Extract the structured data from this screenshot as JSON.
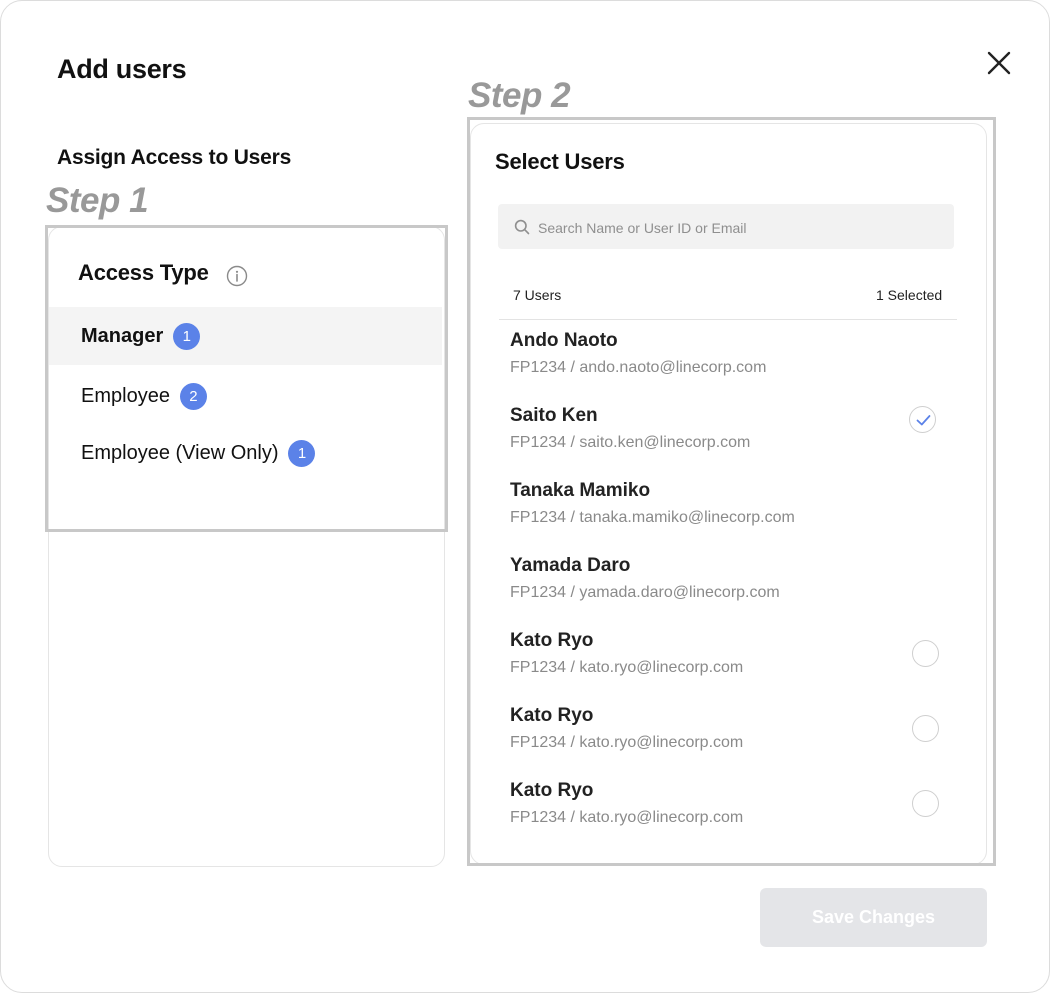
{
  "modal": {
    "title": "Add users",
    "subtitle": "Assign Access to Users",
    "close_icon": "close-icon"
  },
  "steps": {
    "step1": "Step 1",
    "step2": "Step 2"
  },
  "access": {
    "title": "Access Type",
    "info_icon": "info-icon",
    "items": [
      {
        "label": "Manager",
        "count": "1",
        "active": true
      },
      {
        "label": "Employee",
        "count": "2",
        "active": false
      },
      {
        "label": "Employee (View Only)",
        "count": "1",
        "active": false
      }
    ]
  },
  "select": {
    "title": "Select Users",
    "search_placeholder": "Search Name or User ID or Email",
    "users_count": "7 Users",
    "selected_count": "1 Selected",
    "users": [
      {
        "name": "Ando Naoto",
        "meta": "FP1234 / ando.naoto@linecorp.com",
        "state": "none"
      },
      {
        "name": "Saito Ken",
        "meta": "FP1234 / saito.ken@linecorp.com",
        "state": "checked"
      },
      {
        "name": "Tanaka Mamiko",
        "meta": "FP1234 / tanaka.mamiko@linecorp.com",
        "state": "none"
      },
      {
        "name": "Yamada Daro",
        "meta": "FP1234 / yamada.daro@linecorp.com",
        "state": "none"
      },
      {
        "name": "Kato Ryo",
        "meta": "FP1234 / kato.ryo@linecorp.com",
        "state": "unchecked"
      },
      {
        "name": "Kato Ryo",
        "meta": "FP1234 / kato.ryo@linecorp.com",
        "state": "unchecked"
      },
      {
        "name": "Kato Ryo",
        "meta": "FP1234 / kato.ryo@linecorp.com",
        "state": "unchecked"
      }
    ]
  },
  "actions": {
    "save_label": "Save Changes"
  },
  "colors": {
    "accent": "#5b82e8",
    "step_gray": "#999999",
    "disabled_button": "#e4e5e8"
  }
}
